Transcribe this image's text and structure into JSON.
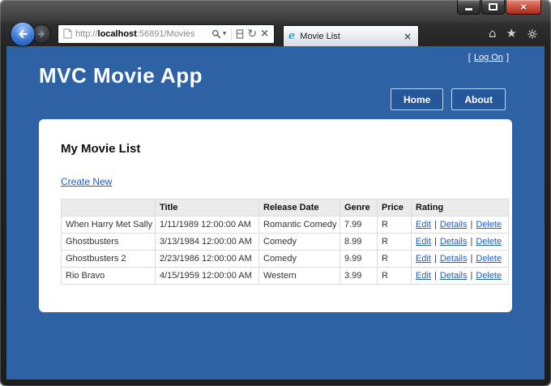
{
  "window": {
    "close_glyph": "×"
  },
  "browser": {
    "url": {
      "prefix": "http://",
      "host": "localhost",
      "path": ":56891/Movies"
    },
    "tab": {
      "title": "Movie List",
      "close_glyph": "×"
    },
    "icons": {
      "dropdown": "▼",
      "refresh": "↻",
      "stop": "×",
      "home": "⌂",
      "favorites": "★",
      "ie": "e"
    }
  },
  "page": {
    "logon": {
      "open": "[",
      "label": "Log On",
      "close": "]"
    },
    "app_title": "MVC Movie App",
    "nav": {
      "home": "Home",
      "about": "About"
    },
    "main": {
      "heading": "My Movie List",
      "create_link": "Create New",
      "table": {
        "headers": [
          "",
          "Title",
          "Release Date",
          "Genre",
          "Price",
          "Rating"
        ],
        "rows": [
          {
            "cells": [
              "When Harry Met Sally",
              "1/11/1989 12:00:00 AM",
              "Romantic Comedy",
              "7.99",
              "R"
            ]
          },
          {
            "cells": [
              "Ghostbusters",
              "3/13/1984 12:00:00 AM",
              "Comedy",
              "8.99",
              "R"
            ]
          },
          {
            "cells": [
              "Ghostbusters 2",
              "2/23/1986 12:00:00 AM",
              "Comedy",
              "9.99",
              "R"
            ]
          },
          {
            "cells": [
              "Rio Bravo",
              "4/15/1959 12:00:00 AM",
              "Western",
              "3.99",
              "R"
            ]
          }
        ],
        "actions": [
          "Edit",
          "Details",
          "Delete"
        ],
        "separator": "|"
      }
    }
  },
  "colors": {
    "page_background": "#2d62a4",
    "link_blue": "#1b5ec4",
    "nav_button_background": "#26579a",
    "table_header_background": "#ebebeb",
    "close_button_red": "#c1402f"
  }
}
